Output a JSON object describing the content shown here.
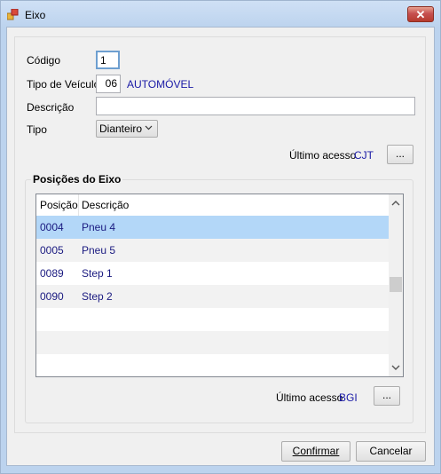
{
  "window": {
    "title": "Eixo",
    "close_label": "✕"
  },
  "form": {
    "codigo_label": "Código",
    "codigo_value": "1",
    "tipo_veiculo_label": "Tipo de Veículo",
    "tipo_veiculo_value": "06",
    "tipo_veiculo_desc": "AUTOMÓVEL",
    "descricao_label": "Descrição",
    "descricao_value": "",
    "tipo_label": "Tipo",
    "tipo_selected": "Dianteiro",
    "ultimo_acesso_label": "Último acesso",
    "ultimo_acesso_value": "CJT",
    "browse_label": "..."
  },
  "posicoes": {
    "legend": "Posições do Eixo",
    "columns": [
      "Posição",
      "Descrição"
    ],
    "rows": [
      {
        "posicao": "0004",
        "descricao": "Pneu 4",
        "selected": true
      },
      {
        "posicao": "0005",
        "descricao": "Pneu 5"
      },
      {
        "posicao": "0089",
        "descricao": "Step 1"
      },
      {
        "posicao": "0090",
        "descricao": "Step 2"
      }
    ],
    "ultimo_acesso_label": "Último acesso",
    "ultimo_acesso_value": "BGI",
    "browse_label": "..."
  },
  "buttons": {
    "confirmar": "Confirmar",
    "cancelar": "Cancelar"
  },
  "colors": {
    "selection": "#b3d7f8",
    "link": "#1a1aa6",
    "row_alt": "#f2f2f2"
  }
}
